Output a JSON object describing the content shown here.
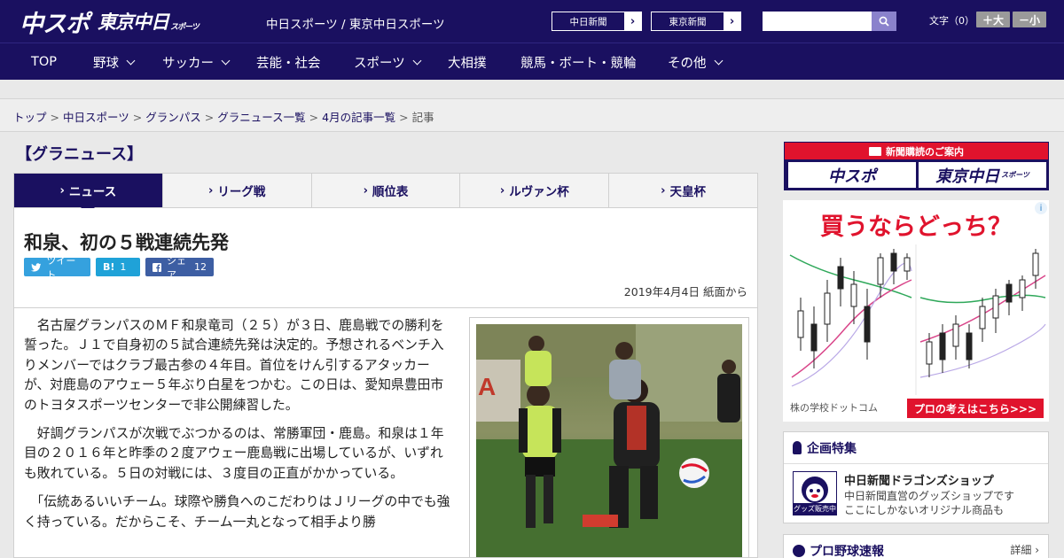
{
  "header": {
    "logo_chunichi_sports": "中スポ",
    "logo_tokyo_chunichi": "東京中日",
    "logo_tokyo_sub": "スポーツ",
    "site_title": "中日スポーツ / 東京中日スポーツ",
    "paper_links": [
      "中日新聞",
      "東京新聞"
    ],
    "search_placeholder": "",
    "font_size_label": "文字（0）",
    "font_bigger": "＋大",
    "font_smaller": "－小"
  },
  "nav": {
    "items": [
      {
        "label": "TOP",
        "dropdown": false
      },
      {
        "label": "野球",
        "dropdown": true
      },
      {
        "label": "サッカー",
        "dropdown": true
      },
      {
        "label": "芸能・社会",
        "dropdown": false
      },
      {
        "label": "スポーツ",
        "dropdown": true
      },
      {
        "label": "大相撲",
        "dropdown": false
      },
      {
        "label": "競馬・ボート・競輪",
        "dropdown": false
      },
      {
        "label": "その他",
        "dropdown": true
      }
    ]
  },
  "breadcrumb": {
    "items": [
      "トップ",
      "中日スポーツ",
      "グランパス",
      "グラニュース一覧",
      "4月の記事一覧"
    ],
    "current": "記事",
    "separator": ">"
  },
  "section": {
    "heading": "【グラニュース】",
    "tabs": [
      "ニュース",
      "リーグ戦",
      "順位表",
      "ルヴァン杯",
      "天皇杯"
    ],
    "active_tab": 0
  },
  "article": {
    "headline": "和泉、初の５戦連続先発",
    "share": {
      "tweet_label": "ツイート",
      "hatena_label": "B!",
      "hatena_count": "1",
      "facebook_label": "シェア",
      "facebook_count": "12"
    },
    "dateline": "2019年4月4日 紙面から",
    "paragraphs": [
      "　名古屋グランパスのＭＦ和泉竜司（２５）が３日、鹿島戦での勝利を誓った。Ｊ１で自身初の５試合連続先発は決定的。予想されるベンチ入りメンバーではクラブ最古参の４年目。首位をけん引するアタッカーが、対鹿島のアウェー５年ぶり白星をつかむ。この日は、愛知県豊田市のトヨタスポーツセンターで非公開練習した。",
      "　好調グランパスが次戦でぶつかるのは、常勝軍団・鹿島。和泉は１年目の２０１６年と昨季の２度アウェー鹿島戦に出場しているが、いずれも敗れている。５日の対戦には、３度目の正直がかかっている。",
      "　「伝統あるいいチーム。球際や勝負へのこだわりはＪリーグの中でも強く持っている。だからこそ、チーム一丸となって相手より勝"
    ]
  },
  "sidebar": {
    "subscribe_banner": {
      "title": "新聞購読のご案内",
      "btn_chunichi": "中スポ",
      "btn_tokyo": "東京中日",
      "btn_tokyo_sub": "スポーツ"
    },
    "ad": {
      "title": "買うならどっち？",
      "sponsor": "株の学校ドットコム",
      "cta": "プロの考えはこちら>>>",
      "info_icon": "i"
    },
    "feature": {
      "heading": "企画特集",
      "title": "中日新聞ドラゴンズショップ",
      "desc_line1": "中日新聞直営のグッズショップです",
      "desc_line2": "ここにしかないオリジナル商品も",
      "thumb_label": "グッズ販売中"
    },
    "baseball": {
      "heading": "プロ野球速報",
      "more": "詳細 ›"
    }
  },
  "colors": {
    "brand_navy": "#1a1060",
    "accent_red": "#e0132d",
    "twitter": "#35a1de",
    "hatena": "#1fa2d8",
    "facebook": "#3d5ea3"
  }
}
